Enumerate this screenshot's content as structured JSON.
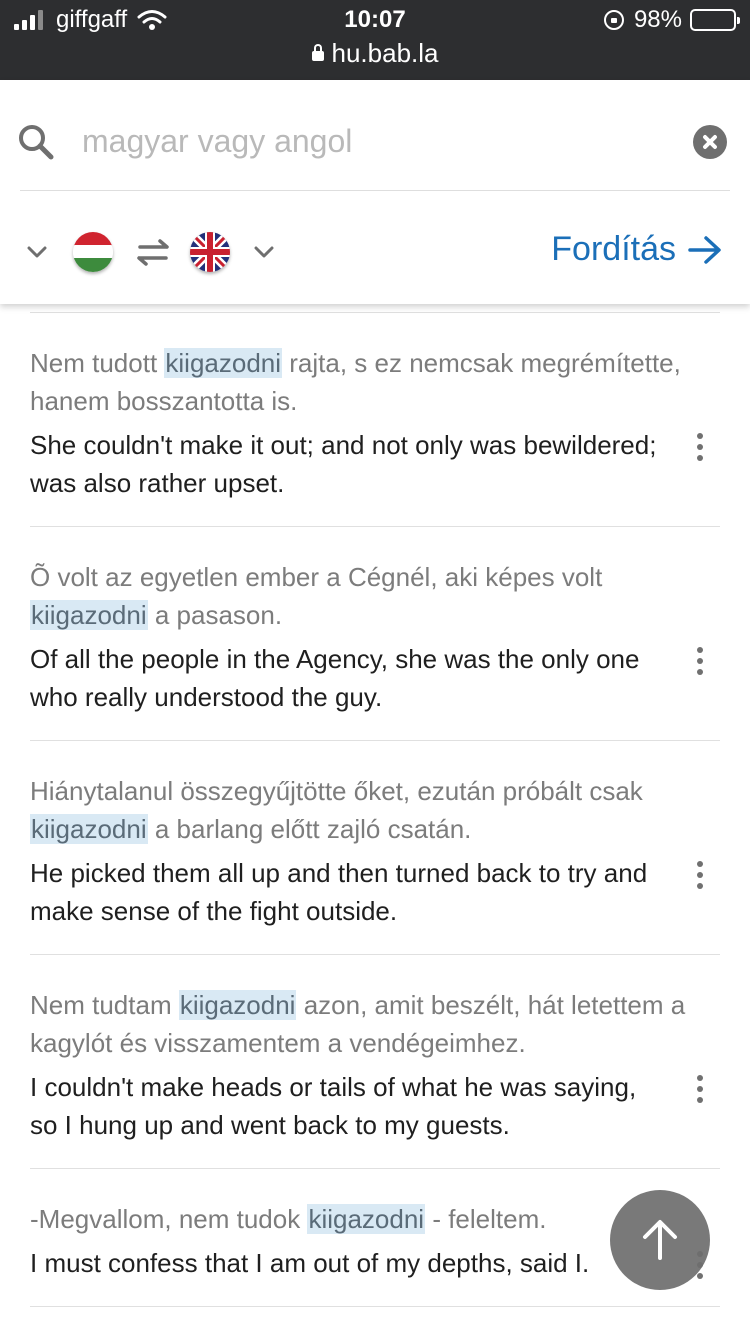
{
  "status_bar": {
    "carrier": "giffgaff",
    "time": "10:07",
    "url": "hu.bab.la",
    "battery": "98%",
    "battery_level": 0.98
  },
  "search": {
    "placeholder": "magyar vagy angol",
    "value": ""
  },
  "languages": {
    "source": "Hungarian",
    "target": "English",
    "translate_label": "Fordítás",
    "colors": {
      "accent": "#1b6fb8"
    }
  },
  "examples": [
    {
      "hu_before": "Nem tudott ",
      "hu_term": "kiigazodni",
      "hu_after": " rajta, s ez nemcsak megrémítette, hanem bosszantotta is.",
      "en": "She couldn't make it out; and not only was bewildered; was also rather upset."
    },
    {
      "hu_before": "Õ volt az egyetlen ember a Cégnél, aki képes volt ",
      "hu_term": "kiigazodni",
      "hu_after": " a pasason.",
      "en": "Of all the people in the Agency, she was the only one who really understood the guy."
    },
    {
      "hu_before": "Hiánytalanul összegyűjtötte őket, ezután próbált csak ",
      "hu_term": "kiigazodni",
      "hu_after": " a barlang előtt zajló csatán.",
      "en": "He picked them all up and then turned back to try and make sense of the fight outside."
    },
    {
      "hu_before": "Nem tudtam ",
      "hu_term": "kiigazodni",
      "hu_after": " azon, amit beszélt, hát letettem a kagylót és visszamentem a vendégeimhez.",
      "en": "I couldn't make heads or tails of what he was saying, so I hung up and went back to my guests."
    },
    {
      "hu_before": "-Megvallom, nem tudok ",
      "hu_term": "kiigazodni",
      "hu_after": " - feleltem.",
      "en": "I must confess that I am out of my depths, said I."
    }
  ]
}
